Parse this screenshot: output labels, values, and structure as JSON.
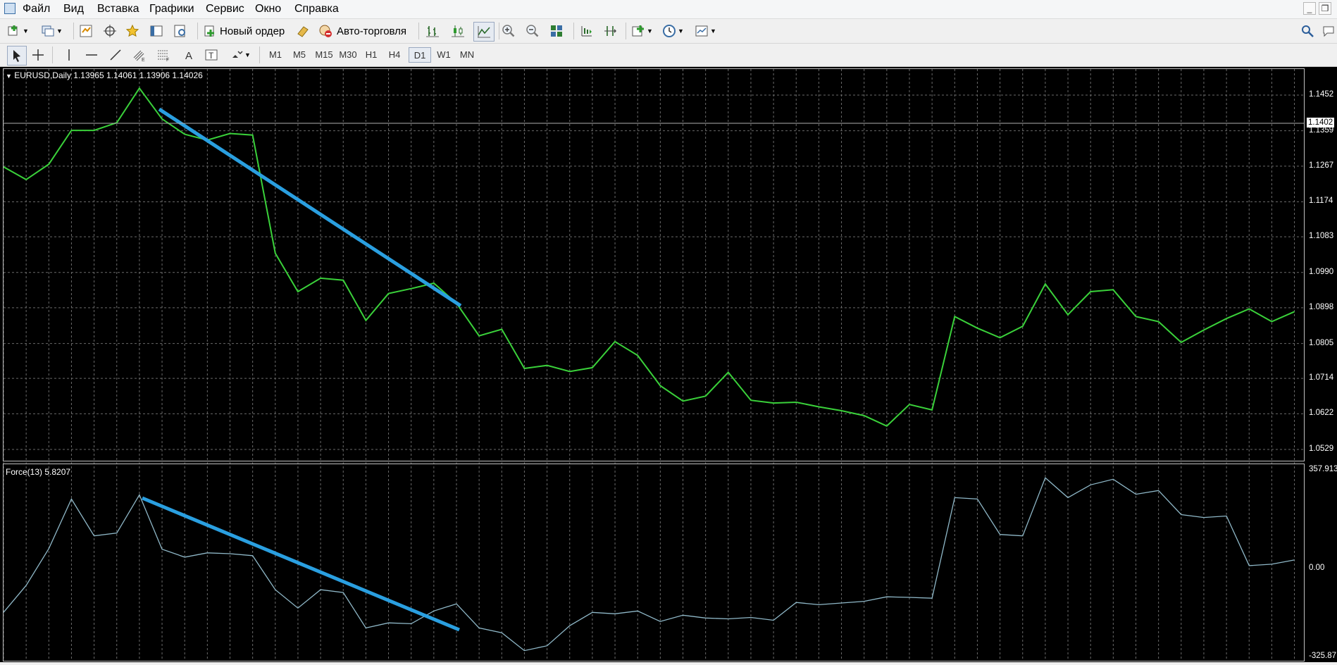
{
  "menu": {
    "items": [
      "Файл",
      "Вид",
      "Вставка",
      "Графики",
      "Сервис",
      "Окно",
      "Справка"
    ]
  },
  "toolbar": {
    "new_order_label": "Новый ордер",
    "autotrade_label": "Авто-торговля"
  },
  "timeframes": [
    "M1",
    "M5",
    "M15",
    "M30",
    "H1",
    "H4",
    "D1",
    "W1",
    "MN"
  ],
  "active_timeframe": "D1",
  "main_chart": {
    "header": "EURUSD,Daily  1.13965 1.14061 1.13906 1.14026",
    "y_ticks": [
      "1.1452",
      "1.1359",
      "1.1267",
      "1.1174",
      "1.1083",
      "1.0990",
      "1.0898",
      "1.0805",
      "1.0714",
      "1.0622",
      "1.0529"
    ],
    "current_price": "1.1402",
    "line_color": "#3ad13a",
    "trendline_color": "#2a9fe0"
  },
  "indicator": {
    "header": "Force(13) 5.8207",
    "y_ticks": [
      "357.913",
      "0.00",
      "-325.87"
    ],
    "line_color": "#8fb8c8"
  },
  "chart_data": [
    {
      "type": "line",
      "title": "EURUSD,Daily",
      "ylim": [
        1.0529,
        1.1452
      ],
      "series": [
        {
          "name": "EURUSD",
          "values": [
            1.1265,
            1.1232,
            1.1272,
            1.136,
            1.136,
            1.138,
            1.147,
            1.139,
            1.135,
            1.1335,
            1.1352,
            1.1348,
            1.104,
            1.094,
            1.0975,
            1.097,
            1.0865,
            1.0935,
            1.0948,
            1.0962,
            1.091,
            1.0825,
            1.0842,
            1.074,
            1.0748,
            1.0732,
            1.0742,
            1.081,
            1.0774,
            1.0695,
            1.0655,
            1.0668,
            1.073,
            1.0657,
            1.065,
            1.0652,
            1.064,
            1.063,
            1.0617,
            1.059,
            1.0646,
            1.0632,
            1.0875,
            1.0845,
            1.082,
            1.085,
            1.096,
            1.088,
            1.094,
            1.0945,
            1.0875,
            1.0862,
            1.0808,
            1.084,
            1.087,
            1.0895,
            1.0862,
            1.0888
          ]
        }
      ]
    },
    {
      "type": "line",
      "title": "Force(13)",
      "ylim": [
        -325.87,
        357.913
      ],
      "series": [
        {
          "name": "Force(13)",
          "values": [
            -155,
            -60,
            70,
            245,
            115,
            125,
            260,
            68,
            40,
            55,
            52,
            45,
            -75,
            -140,
            -75,
            -85,
            -210,
            -192,
            -195,
            -150,
            -125,
            -210,
            -227,
            -290,
            -273,
            -202,
            -155,
            -160,
            -150,
            -187,
            -165,
            -175,
            -178,
            -173,
            -183,
            -120,
            -128,
            -122,
            -116,
            -100,
            -102,
            -105,
            250,
            245,
            120,
            115,
            320,
            250,
            295,
            315,
            262,
            275,
            190,
            180,
            185,
            10,
            15,
            30
          ]
        }
      ]
    }
  ]
}
